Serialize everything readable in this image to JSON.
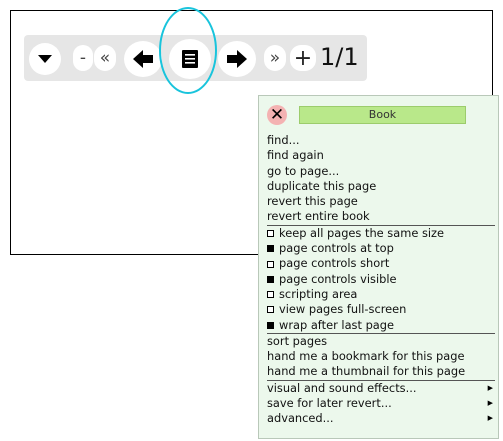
{
  "page_controls": {
    "menu_toggle_icon": "triangle-down-icon",
    "zoom_out_label": "-",
    "first_page_label": "«",
    "prev_page_icon": "arrow-left-icon",
    "page_menu_icon": "menu-lines-icon",
    "next_page_icon": "arrow-right-icon",
    "last_page_label": "»",
    "zoom_in_label": "+",
    "page_counter": "1/1"
  },
  "highlight_color": "#19c4dc",
  "book_menu": {
    "close_icon": "close-x-icon",
    "title": "Book",
    "actions": [
      {
        "label": "find..."
      },
      {
        "label": "find again"
      },
      {
        "label": "go to page..."
      },
      {
        "label": "duplicate this page"
      },
      {
        "label": "revert this page"
      },
      {
        "label": "revert entire book"
      }
    ],
    "options": [
      {
        "label": "keep all pages the same size",
        "checked": false
      },
      {
        "label": "page controls at top",
        "checked": true
      },
      {
        "label": "page controls short",
        "checked": false
      },
      {
        "label": "page controls visible",
        "checked": true
      },
      {
        "label": "scripting area",
        "checked": false
      },
      {
        "label": "view pages full-screen",
        "checked": false
      },
      {
        "label": "wrap after last page",
        "checked": true
      }
    ],
    "sorting": [
      {
        "label": "sort pages"
      },
      {
        "label": "hand me a bookmark for this page"
      },
      {
        "label": "hand me a thumbnail for this page"
      }
    ],
    "submenus": [
      {
        "label": "visual and sound effects..."
      },
      {
        "label": "save for later revert..."
      },
      {
        "label": "advanced..."
      }
    ],
    "colors": {
      "background": "#ecf8ec",
      "title_bar": "#b9e88a",
      "close_button": "#f4b2b2"
    }
  }
}
